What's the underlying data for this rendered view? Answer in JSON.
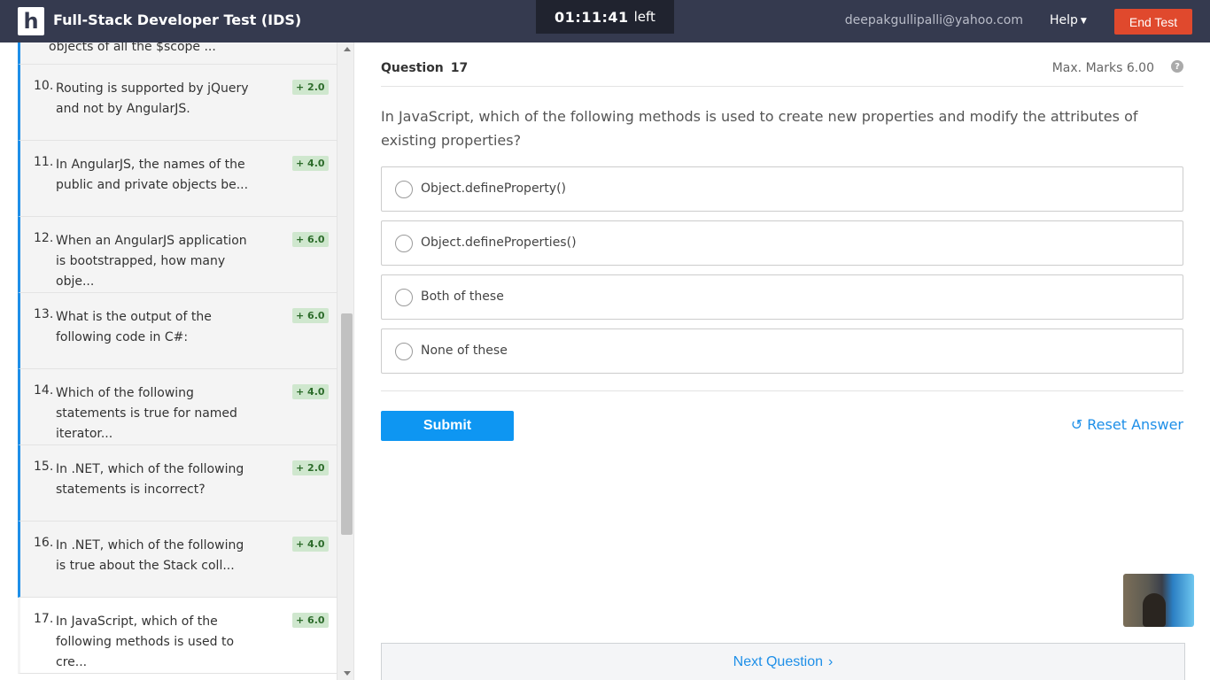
{
  "header": {
    "logo": "h",
    "title": "Full-Stack Developer Test (IDS)",
    "timer_value": "01:11:41",
    "timer_suffix": "left",
    "user_email": "deepakgullipalli@yahoo.com",
    "help_label": "Help",
    "end_test_label": "End Test"
  },
  "sidebar": {
    "partial_item": "objects of all the $scope ...",
    "items": [
      {
        "num": "10.",
        "text": "Routing is supported by jQuery and not by AngularJS.",
        "marks": "+ 2.0",
        "current": false
      },
      {
        "num": "11.",
        "text": "In AngularJS, the names of the public and private objects be...",
        "marks": "+ 4.0",
        "current": false
      },
      {
        "num": "12.",
        "text": "When an AngularJS application is bootstrapped, how many obje...",
        "marks": "+ 6.0",
        "current": false
      },
      {
        "num": "13.",
        "text": "What is the output of the following code in C#:",
        "marks": "+ 6.0",
        "current": false
      },
      {
        "num": "14.",
        "text": "Which of the following statements is true for named iterator...",
        "marks": "+ 4.0",
        "current": false
      },
      {
        "num": "15.",
        "text": "In .NET, which of the following statements is incorrect?",
        "marks": "+ 2.0",
        "current": false
      },
      {
        "num": "16.",
        "text": "In .NET, which of the following is true about the Stack coll...",
        "marks": "+ 4.0",
        "current": false
      },
      {
        "num": "17.",
        "text": "In JavaScript, which of the following methods is used to cre...",
        "marks": "+ 6.0",
        "current": true
      }
    ]
  },
  "question": {
    "label": "Question",
    "number": "17",
    "max_marks": "Max. Marks 6.00",
    "help_icon": "?",
    "text": "In JavaScript, which of the following methods is used to create new properties and modify the attributes of existing properties?",
    "options": [
      "Object.defineProperty()",
      "Object.defineProperties()",
      "Both of these",
      "None of these"
    ]
  },
  "actions": {
    "submit_label": "Submit",
    "reset_label": "Reset Answer",
    "reset_icon": "↺",
    "next_label": "Next Question",
    "next_icon": "›"
  },
  "colors": {
    "header_bg": "#353a4f",
    "accent": "#1e8fe8",
    "end_test": "#e0492d",
    "badge_bg": "#cfe7ce"
  }
}
